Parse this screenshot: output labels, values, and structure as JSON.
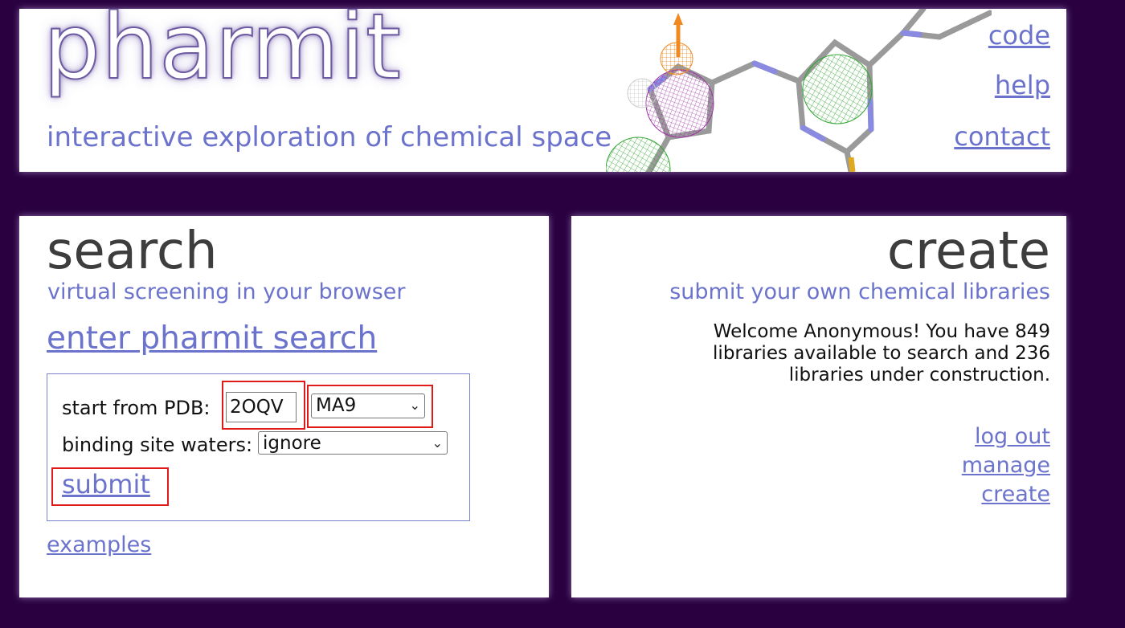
{
  "header": {
    "logo": "pharmit",
    "tagline": "interactive exploration of chemical space",
    "nav": [
      {
        "label": "code"
      },
      {
        "label": "help"
      },
      {
        "label": "contact"
      }
    ]
  },
  "search": {
    "title": "search",
    "subtitle": "virtual screening in your browser",
    "enter_link": "enter pharmit search",
    "pdb_label": "start from PDB:",
    "pdb_value": "2OQV",
    "ligand_value": "MA9",
    "waters_label": "binding site waters:",
    "waters_value": "ignore",
    "submit_label": "submit",
    "examples_label": "examples"
  },
  "create": {
    "title": "create",
    "subtitle": "submit your own chemical libraries",
    "welcome": "Welcome Anonymous! You have 849 libraries available to search and 236 libraries under construction.",
    "links": [
      {
        "label": "log out"
      },
      {
        "label": "manage"
      },
      {
        "label": "create"
      }
    ]
  },
  "colors": {
    "background": "#2a0040",
    "accent": "#6b73cc",
    "highlight": "#e01919"
  }
}
